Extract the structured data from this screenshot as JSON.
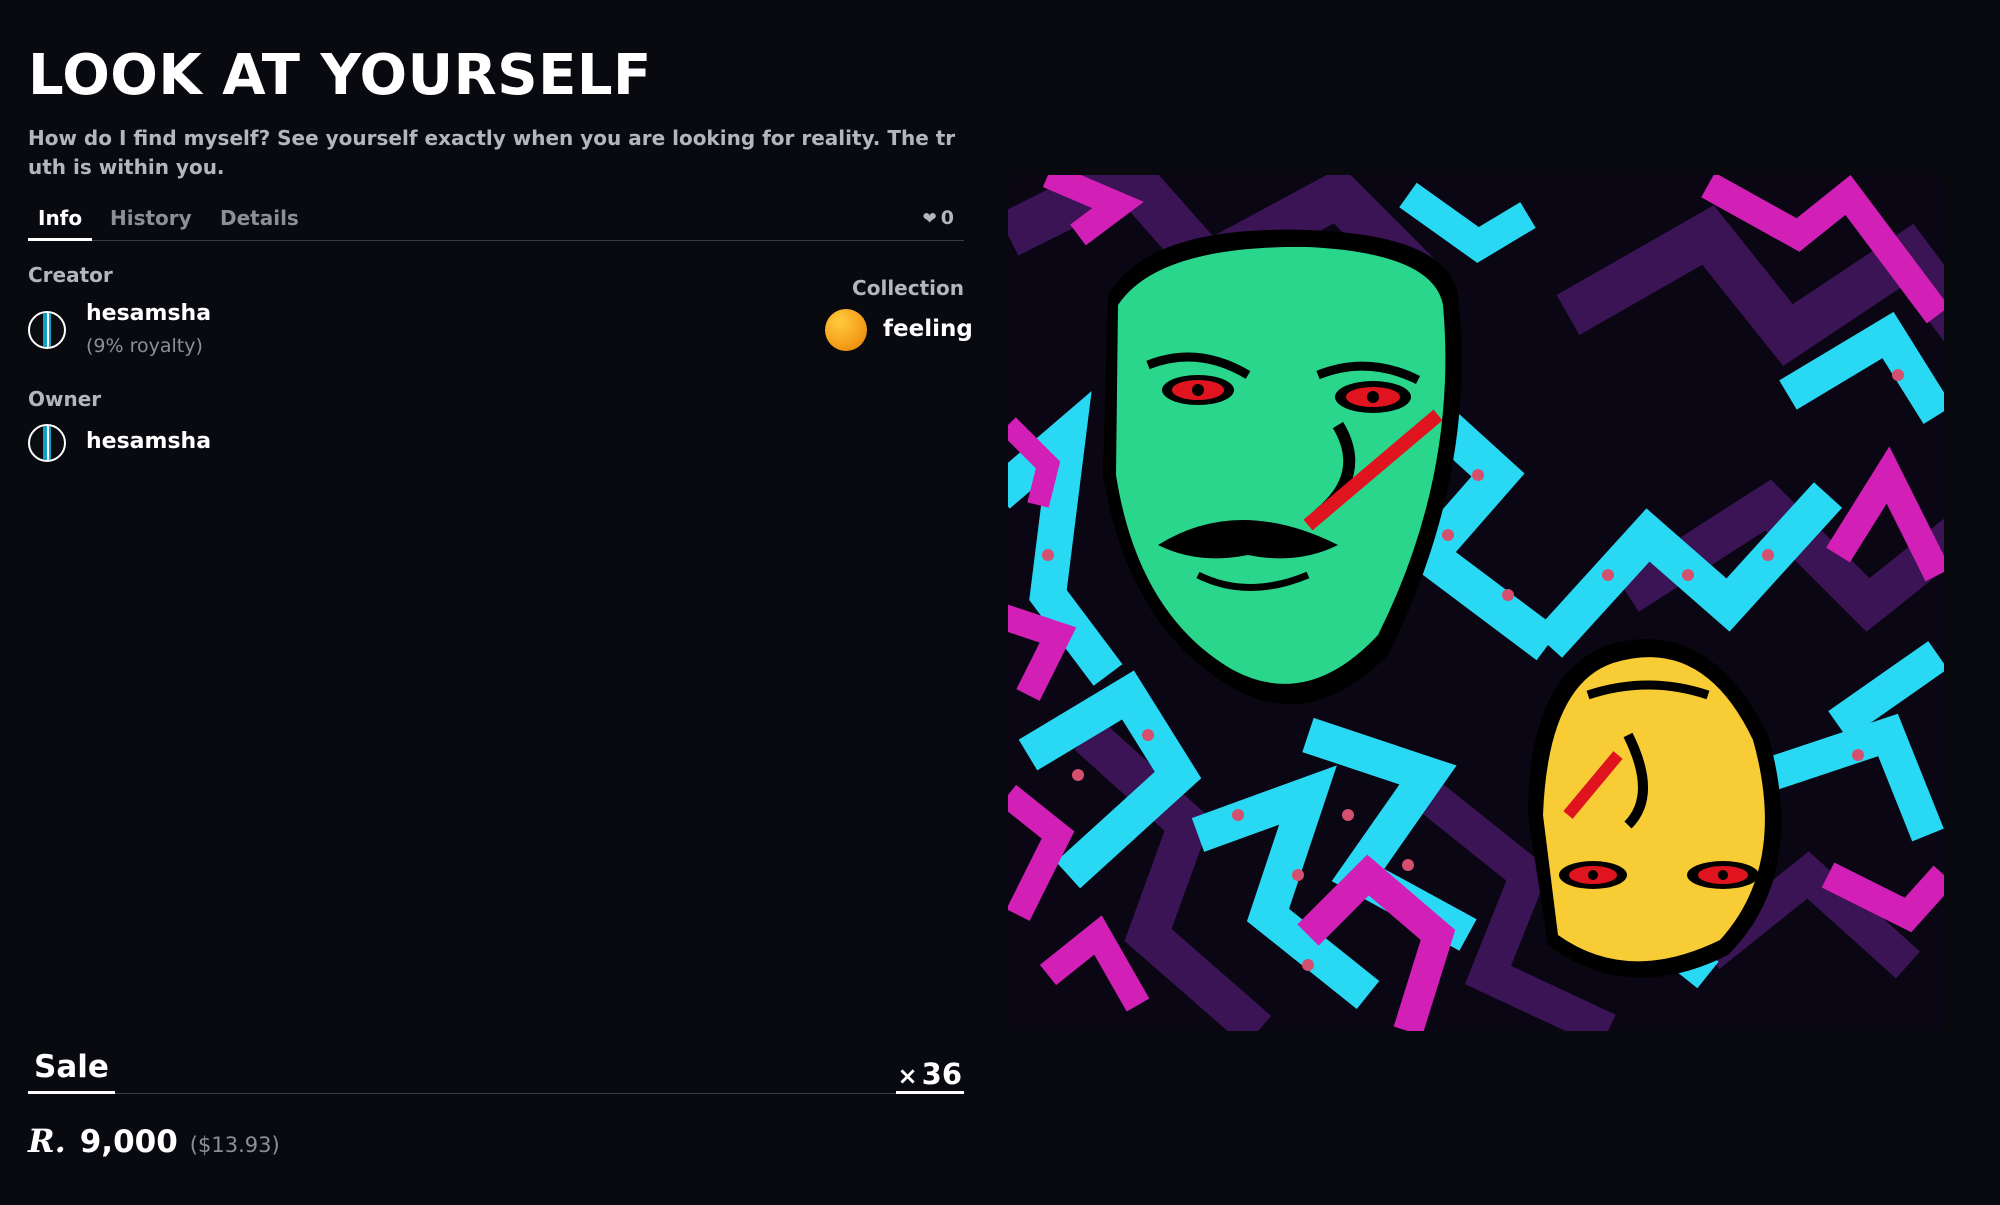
{
  "item": {
    "title": "LOOK AT YOURSELF",
    "description": "How do I find myself? See yourself exactly when you are looking for reality. The truth is within you."
  },
  "tabs": [
    "Info",
    "History",
    "Details"
  ],
  "likes": {
    "icon": "heart-icon",
    "count": "0"
  },
  "creator": {
    "label": "Creator",
    "name": "hesamsha",
    "royalty": "(9% royalty)"
  },
  "owner": {
    "label": "Owner",
    "name": "hesamsha"
  },
  "collection": {
    "label": "Collection",
    "name": "feeling"
  },
  "sale": {
    "title": "Sale",
    "quantity_prefix": "×",
    "quantity": "36",
    "currency_symbol": "R.",
    "price": "9,000",
    "usd": "($13.93)"
  },
  "colors": {
    "background": "#080a0f",
    "accent_cyan": "#12a0c8",
    "collection_orange": "#f7a21c"
  }
}
